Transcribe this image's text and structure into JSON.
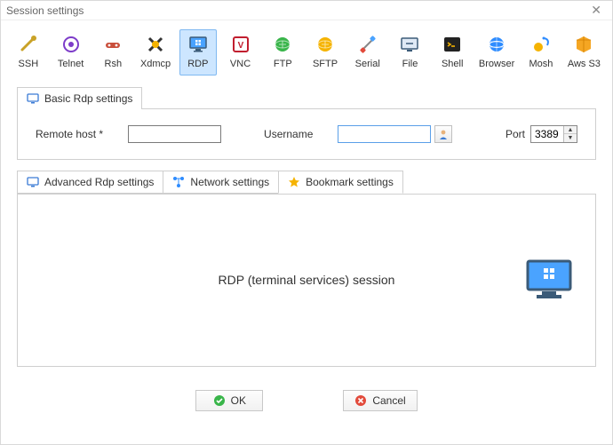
{
  "window": {
    "title": "Session settings"
  },
  "protocols": [
    {
      "id": "ssh",
      "label": "SSH"
    },
    {
      "id": "telnet",
      "label": "Telnet"
    },
    {
      "id": "rsh",
      "label": "Rsh"
    },
    {
      "id": "xdmcp",
      "label": "Xdmcp"
    },
    {
      "id": "rdp",
      "label": "RDP",
      "selected": true
    },
    {
      "id": "vnc",
      "label": "VNC"
    },
    {
      "id": "ftp",
      "label": "FTP"
    },
    {
      "id": "sftp",
      "label": "SFTP"
    },
    {
      "id": "serial",
      "label": "Serial"
    },
    {
      "id": "file",
      "label": "File"
    },
    {
      "id": "shell",
      "label": "Shell"
    },
    {
      "id": "browser",
      "label": "Browser"
    },
    {
      "id": "mosh",
      "label": "Mosh"
    },
    {
      "id": "awss3",
      "label": "Aws S3"
    }
  ],
  "basicTab": {
    "label": "Basic Rdp settings"
  },
  "fields": {
    "remoteHostLabel": "Remote host *",
    "remoteHostValue": "",
    "usernameLabel": "Username",
    "usernameValue": "",
    "portLabel": "Port",
    "portValue": "3389"
  },
  "subTabs": {
    "advanced": "Advanced Rdp settings",
    "network": "Network settings",
    "bookmark": "Bookmark settings"
  },
  "hero": {
    "text": "RDP (terminal services) session"
  },
  "buttons": {
    "ok": "OK",
    "cancel": "Cancel"
  },
  "colors": {
    "accent": "#2e8cff",
    "selectBg": "#cde6ff"
  }
}
